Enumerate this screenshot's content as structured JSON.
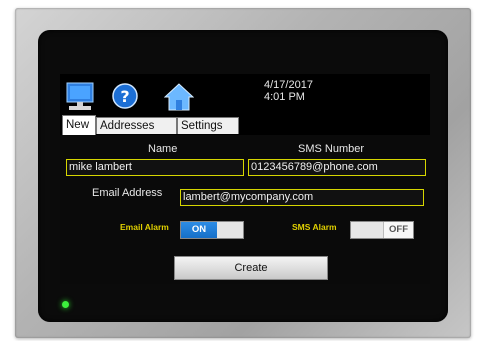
{
  "header": {
    "date": "4/17/2017",
    "time": "4:01 PM",
    "icons": [
      "computer-icon",
      "help-icon",
      "home-icon"
    ]
  },
  "tabs": [
    {
      "label": "New",
      "active": true
    },
    {
      "label": "Addresses",
      "active": false
    },
    {
      "label": "Settings",
      "active": false
    }
  ],
  "form": {
    "name_label": "Name",
    "name_value": "mike lambert",
    "sms_label": "SMS Number",
    "sms_value": "0123456789@phone.com",
    "email_label": "Email Address",
    "email_value": "lambert@mycompany.com",
    "email_alarm_label": "Email Alarm",
    "email_alarm_state": "ON",
    "sms_alarm_label": "SMS Alarm",
    "sms_alarm_state": "OFF",
    "create_label": "Create"
  },
  "colors": {
    "field_border": "#d6d600",
    "alarm_label": "#e0d000",
    "toggle_on": "#1f7fd8",
    "status_led": "#3cf03c"
  }
}
